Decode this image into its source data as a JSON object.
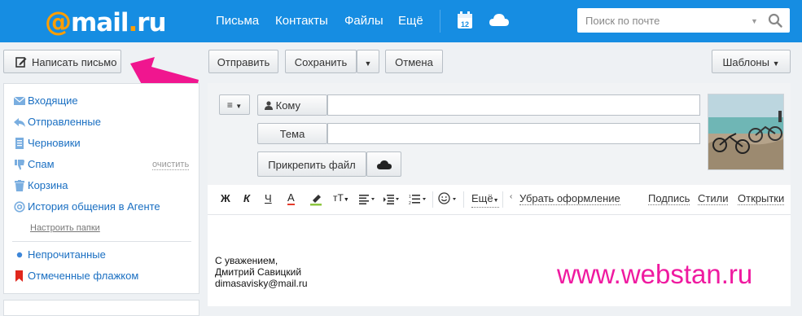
{
  "header": {
    "logo": {
      "at": "@",
      "main": "mail",
      "dot": ".",
      "tld": "ru"
    },
    "nav": [
      "Письма",
      "Контакты",
      "Файлы",
      "Ещё"
    ],
    "calendar_day": "12",
    "search": {
      "placeholder": "Поиск по почте"
    }
  },
  "toolbar": {
    "compose": "Написать письмо",
    "send": "Отправить",
    "save": "Сохранить",
    "cancel": "Отмена",
    "templates": "Шаблоны"
  },
  "sidebar": {
    "folders": [
      {
        "label": "Входящие",
        "icon": "inbox-icon"
      },
      {
        "label": "Отправленные",
        "icon": "reply-icon"
      },
      {
        "label": "Черновики",
        "icon": "draft-icon"
      },
      {
        "label": "Спам",
        "icon": "thumbs-down-icon"
      },
      {
        "label": "Корзина",
        "icon": "trash-icon"
      },
      {
        "label": "История общения в Агенте",
        "icon": "at-icon"
      }
    ],
    "clean": "очистить",
    "setup": "Настроить папки",
    "filters": [
      {
        "label": "Непрочитанные",
        "icon": "unread-dot-icon"
      },
      {
        "label": "Отмеченные флажком",
        "icon": "flag-icon"
      }
    ]
  },
  "compose": {
    "to_label": "Кому",
    "subject_label": "Тема",
    "attach_label": "Прикрепить файл"
  },
  "editor": {
    "bold": "Ж",
    "italic": "К",
    "underline": "Ч",
    "text_color": "А",
    "font_size": "тТ",
    "more": "Ещё",
    "remove_format": "Убрать оформление",
    "signature": "Подпись",
    "styles": "Стили",
    "cards": "Открытки"
  },
  "body": {
    "lines": [
      "С уважением,",
      "Дмитрий Савицкий",
      "dimasavisky@mail.ru"
    ]
  },
  "watermark": "www.webstan.ru",
  "colors": {
    "header_bg": "#168de2",
    "logo_accent": "#ff9e00",
    "link": "#1a6fc2",
    "arrow": "#f0168f",
    "watermark": "#ef1aa0"
  }
}
